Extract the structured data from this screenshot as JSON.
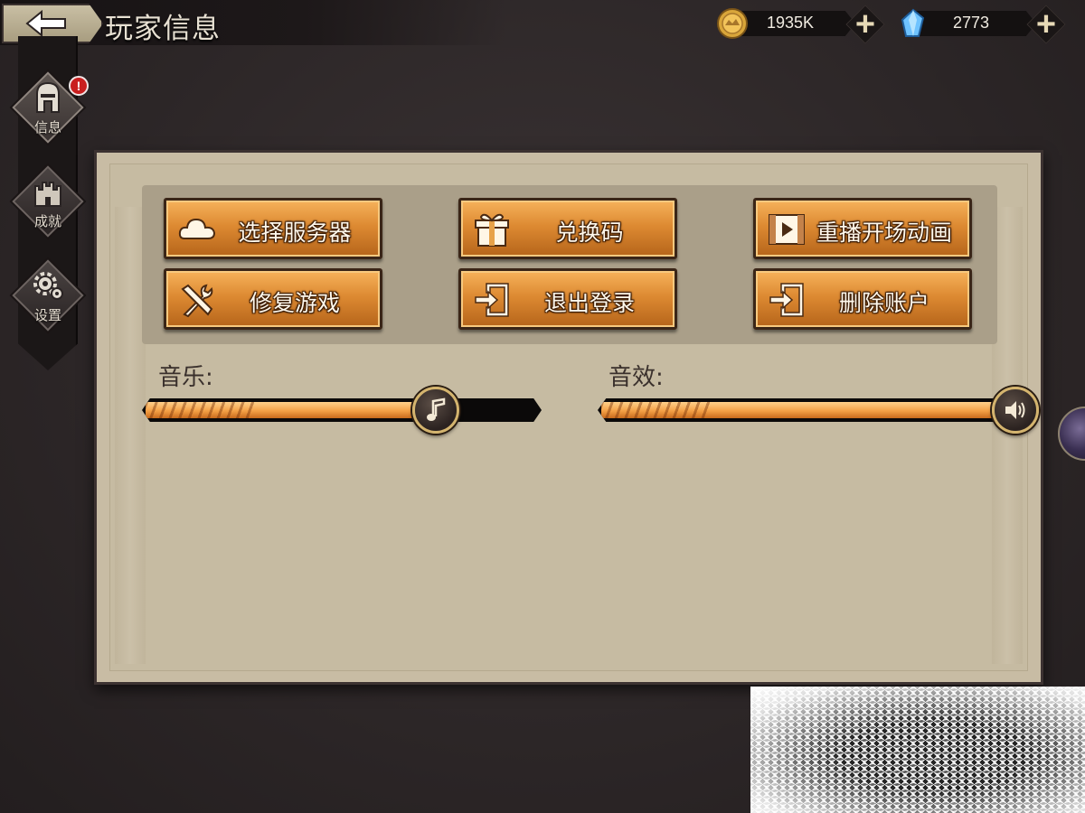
{
  "header": {
    "title": "玩家信息",
    "back_icon": "back-arrow-icon"
  },
  "currencies": [
    {
      "name": "gold",
      "icon": "gold-coin-icon",
      "amount": "1935K",
      "add_label": "+"
    },
    {
      "name": "diamond",
      "icon": "blue-crystal-icon",
      "amount": "2773",
      "add_label": "+"
    }
  ],
  "sidebar": {
    "tabs": [
      {
        "label": "信息",
        "icon": "helmet-icon",
        "badge": "!",
        "active": true
      },
      {
        "label": "成就",
        "icon": "castle-icon",
        "active": false
      },
      {
        "label": "设置",
        "icon": "gear-icon",
        "active": false
      }
    ]
  },
  "buttons": [
    {
      "label": "选择服务器",
      "icon": "cloud-icon"
    },
    {
      "label": "兑换码",
      "icon": "gift-icon"
    },
    {
      "label": "重播开场动画",
      "icon": "video-play-icon"
    },
    {
      "label": "修复游戏",
      "icon": "tools-icon"
    },
    {
      "label": "退出登录",
      "icon": "logout-icon"
    },
    {
      "label": "删除账户",
      "icon": "logout-icon"
    }
  ],
  "sliders": {
    "music": {
      "label": "音乐:",
      "icon": "music-note-icon",
      "value": 0.74
    },
    "sfx": {
      "label": "音效:",
      "icon": "speaker-icon",
      "value": 1.0
    }
  },
  "colors": {
    "button_orange": "#dd8a32",
    "panel_parchment": "#c8bca4",
    "background": "#2c2627",
    "badge_red": "#c91f1f"
  }
}
